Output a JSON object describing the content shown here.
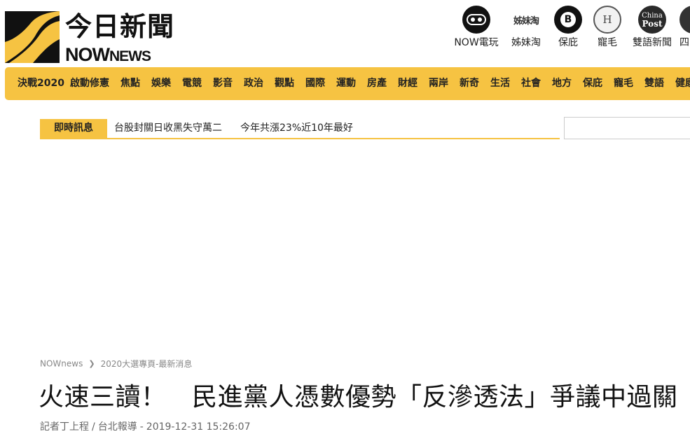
{
  "brand": {
    "name_cn": "今日新聞",
    "name_en_big": "NOW",
    "name_en_small": "NEWS"
  },
  "partners": [
    {
      "label": "NOW電玩",
      "icon": "gamepad-icon"
    },
    {
      "label": "姊妹淘",
      "icon": "sister-logo",
      "logo_text": "姊妹淘"
    },
    {
      "label": "保庇",
      "icon": "baobi-logo",
      "logo_text": "B"
    },
    {
      "label": "寵毛",
      "icon": "pet-logo",
      "logo_text": "H"
    },
    {
      "label": "雙語新聞",
      "icon": "china-post-logo",
      "logo_text_top": "China",
      "logo_text_bottom": "Post"
    },
    {
      "label": "四",
      "icon": "partial-logo"
    }
  ],
  "nav": [
    "決戰2020",
    "啟動修憲",
    "焦點",
    "娛樂",
    "電競",
    "影音",
    "政治",
    "觀點",
    "國際",
    "運動",
    "房產",
    "財經",
    "兩岸",
    "新奇",
    "生活",
    "社會",
    "地方",
    "保庇",
    "寵毛",
    "雙語",
    "健康"
  ],
  "ticker": {
    "label": "即時訊息",
    "items": [
      "台股封關日收黑失守萬二",
      "今年共漲23%近10年最好"
    ]
  },
  "breadcrumb": [
    "NOWnews",
    "2020大選專頁-最新消息"
  ],
  "article": {
    "title": "火速三讀！　民進黨人憑數優勢「反滲透法」爭議中過關",
    "author": "記者丁上程",
    "desk": "台北報導",
    "datetime": "2019-12-31 15:26:07"
  },
  "colors": {
    "accent": "#f6c342",
    "text": "#222222",
    "muted": "#888888"
  }
}
